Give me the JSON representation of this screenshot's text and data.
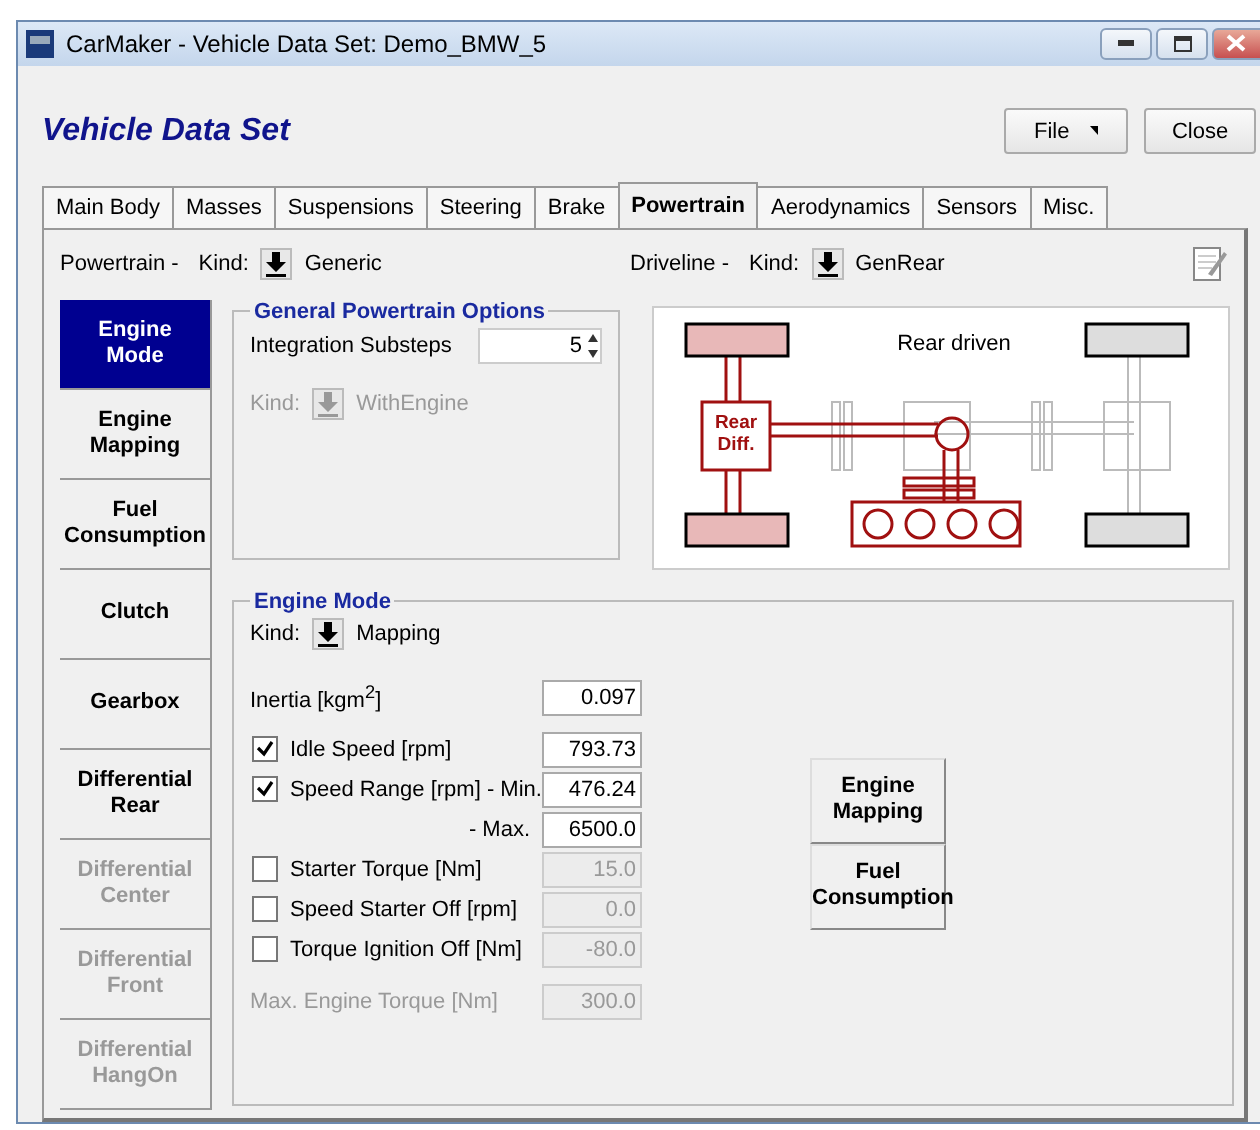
{
  "window": {
    "title": "CarMaker - Vehicle Data Set: Demo_BMW_5"
  },
  "header": {
    "title": "Vehicle Data Set",
    "file_button": "File",
    "close_button": "Close"
  },
  "tabs": [
    {
      "label": "Main Body",
      "selected": false
    },
    {
      "label": "Masses",
      "selected": false
    },
    {
      "label": "Suspensions",
      "selected": false
    },
    {
      "label": "Steering",
      "selected": false
    },
    {
      "label": "Brake",
      "selected": false
    },
    {
      "label": "Powertrain",
      "selected": true
    },
    {
      "label": "Aerodynamics",
      "selected": false
    },
    {
      "label": "Sensors",
      "selected": false
    },
    {
      "label": "Misc.",
      "selected": false
    }
  ],
  "powertrain_kind": {
    "label": "Powertrain -",
    "kind_label": "Kind:",
    "value": "Generic"
  },
  "driveline_kind": {
    "label": "Driveline -",
    "kind_label": "Kind:",
    "value": "GenRear"
  },
  "side_tabs": [
    {
      "label": "Engine Mode",
      "selected": true,
      "disabled": false
    },
    {
      "label": "Engine Mapping",
      "selected": false,
      "disabled": false
    },
    {
      "label": "Fuel Consumption",
      "selected": false,
      "disabled": false
    },
    {
      "label": "Clutch",
      "selected": false,
      "disabled": false
    },
    {
      "label": "Gearbox",
      "selected": false,
      "disabled": false
    },
    {
      "label": "Differential Rear",
      "selected": false,
      "disabled": false
    },
    {
      "label": "Differential Center",
      "selected": false,
      "disabled": true
    },
    {
      "label": "Differential Front",
      "selected": false,
      "disabled": true
    },
    {
      "label": "Differential HangOn",
      "selected": false,
      "disabled": true
    }
  ],
  "general_options": {
    "title": "General Powertrain Options",
    "substeps_label": "Integration Substeps",
    "substeps_value": "5",
    "kind_label": "Kind:",
    "kind_value": "WithEngine",
    "kind_disabled": true
  },
  "diagram": {
    "title": "Rear driven",
    "diff_label": "Rear Diff."
  },
  "engine_mode": {
    "title": "Engine Mode",
    "kind_label": "Kind:",
    "kind_value": "Mapping",
    "fields": [
      {
        "kind": "plain",
        "label": "Inertia [kgm$^{2}$]",
        "value": "0.097",
        "disabled": false
      },
      {
        "kind": "check",
        "label": "Idle Speed [rpm]",
        "value": "793.73",
        "checked": true
      },
      {
        "kind": "check",
        "label": "Speed Range [rpm] - Min.",
        "value": "476.24",
        "checked": true
      },
      {
        "kind": "sub",
        "label": "- Max.",
        "value": "6500.0",
        "disabled": false
      },
      {
        "kind": "check",
        "label": "Starter Torque [Nm]",
        "value": "15.0",
        "checked": false
      },
      {
        "kind": "check",
        "label": "Speed Starter Off [rpm]",
        "value": "0.0",
        "checked": false
      },
      {
        "kind": "check",
        "label": "Torque Ignition Off [Nm]",
        "value": "-80.0",
        "checked": false
      },
      {
        "kind": "plain",
        "label": "Max. Engine Torque [Nm]",
        "value": "300.0",
        "disabled": true
      }
    ],
    "buttons": [
      "Engine Mapping",
      "Fuel Consumption"
    ]
  }
}
